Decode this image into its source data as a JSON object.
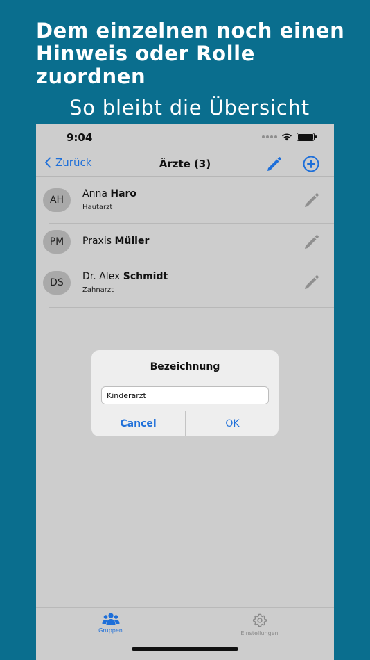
{
  "promo": {
    "headline": "Dem einzelnen noch einen Hinweis oder Rolle zuordnen",
    "subline": "So bleibt die Übersicht"
  },
  "status": {
    "time": "9:04"
  },
  "nav": {
    "back_label": "Zurück",
    "title": "Ärzte (3)"
  },
  "contacts": [
    {
      "initials": "AH",
      "first": "Anna",
      "last": "Haro",
      "note": "Hautarzt"
    },
    {
      "initials": "PM",
      "first": "Praxis",
      "last": "Müller",
      "note": ""
    },
    {
      "initials": "DS",
      "first": "Dr. Alex",
      "last": "Schmidt",
      "note": "Zahnarzt"
    }
  ],
  "dialog": {
    "title": "Bezeichnung",
    "input_value": "Kinderarzt",
    "cancel_label": "Cancel",
    "ok_label": "OK"
  },
  "tabs": {
    "groups_label": "Gruppen",
    "settings_label": "Einstellungen"
  },
  "colors": {
    "background": "#0a6e8e",
    "accent": "#1e6fd9",
    "screen_dimmed": "#cdcdcd"
  }
}
